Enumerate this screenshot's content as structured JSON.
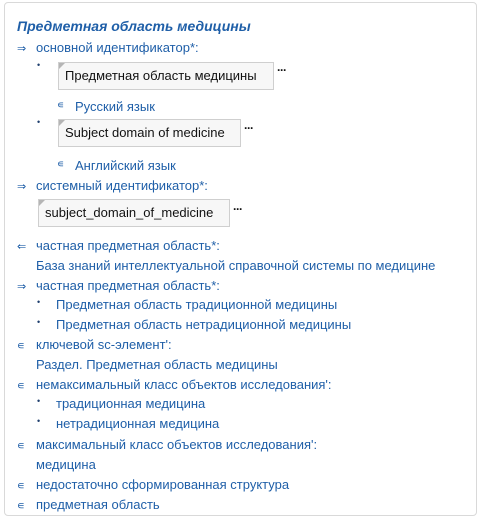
{
  "title": "Предметная область медицины",
  "arrows": {
    "right": "⇒",
    "left": "⇐",
    "membership": "∊"
  },
  "bullet": "•",
  "ellipsis": "···",
  "sections": {
    "main_identifier": {
      "label": "основной идентификатор*:",
      "values": [
        {
          "text": "Предметная область медицины",
          "lang": "Русский язык"
        },
        {
          "text": "Subject domain of medicine",
          "lang": "Английский язык"
        }
      ]
    },
    "system_identifier": {
      "label": "системный идентификатор*:",
      "value": "subject_domain_of_medicine"
    },
    "private_domain_in": {
      "label": "частная предметная область*:",
      "value": "База знаний интеллектуальной справочной системы по медицине"
    },
    "private_domain_out": {
      "label": "частная предметная область*:",
      "items": [
        "Предметная область традиционной медицины",
        "Предметная область нетрадиционной медицины"
      ]
    },
    "key_element": {
      "label": "ключевой sc-элемент':",
      "value": "Раздел. Предметная область медицины"
    },
    "nonmax_class": {
      "label": "немаксимальный класс объектов исследования':",
      "items": [
        "традиционная медицина",
        "нетрадиционная медицина"
      ]
    },
    "max_class": {
      "label": "максимальный класс объектов исследования':",
      "value": "медицина"
    },
    "memberships": [
      "недостаточно сформированная структура",
      "предметная область"
    ]
  }
}
